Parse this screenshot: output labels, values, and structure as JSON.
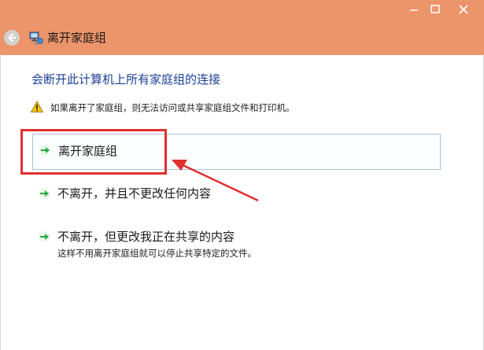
{
  "window": {
    "title": "离开家庭组",
    "titlebar_color": "#ec946a",
    "controls": [
      "minimize-icon",
      "maximize-icon",
      "close-icon"
    ]
  },
  "content": {
    "heading": "会断开此计算机上所有家庭组的连接",
    "warning": "如果离开了家庭组，则无法访问或共享家庭组文件和打印机。",
    "options": [
      {
        "title": "离开家庭组",
        "description": "",
        "selected": true
      },
      {
        "title": "不离开，并且不更改任何内容",
        "description": "",
        "selected": false
      },
      {
        "title": "不离开，但更改我正在共享的内容",
        "description": "这样不用离开家庭组就可以停止共享特定的文件。",
        "selected": false
      }
    ]
  },
  "colors": {
    "heading": "#1b3f95",
    "annotation": "#e0302f",
    "option_arrow": "#2aa845"
  }
}
